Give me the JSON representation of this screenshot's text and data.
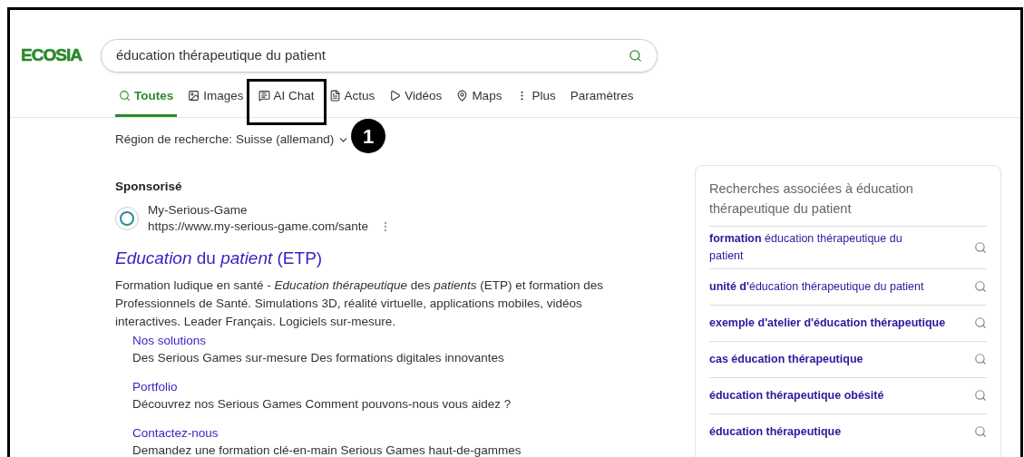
{
  "logo": "ECOSIA",
  "search": {
    "value": "éducation thérapeutique du patient"
  },
  "tabs": [
    {
      "label": "Toutes",
      "selected": true
    },
    {
      "label": "Images",
      "selected": false
    },
    {
      "label": "AI Chat",
      "selected": false
    },
    {
      "label": "Actus",
      "selected": false
    },
    {
      "label": "Vidéos",
      "selected": false
    },
    {
      "label": "Maps",
      "selected": false
    },
    {
      "label": "Plus",
      "selected": false
    },
    {
      "label": "Paramètres",
      "selected": false
    }
  ],
  "annotation": {
    "badge": "1"
  },
  "region": {
    "label": "Région de recherche:",
    "value": "Suisse (allemand)"
  },
  "ad": {
    "sponsored": "Sponsorisé",
    "site_name": "My-Serious-Game",
    "url": "https://www.my-serious-game.com/sante",
    "title": "*Education* du *patient* (ETP)",
    "description": "Formation ludique en santé - *Education thérapeutique* des *patients* (ETP) et formation des Professionnels de Santé. Simulations 3D, réalité virtuelle, applications mobiles, vidéos interactives. Leader Français. Logiciels sur-mesure.",
    "sitelinks": [
      {
        "title": "Nos solutions",
        "text": "Des Serious Games sur-mesure Des formations digitales innovantes"
      },
      {
        "title": "Portfolio",
        "text": "Découvrez nos Serious Games Comment pouvons-nous vous aidez ?"
      },
      {
        "title": "Contactez-nous",
        "text": "Demandez une formation clé-en-main Serious Games haut-de-gammes"
      }
    ]
  },
  "related": {
    "title": "Recherches associées à éducation thérapeutique du patient",
    "items": [
      {
        "text": "**formation** éducation thérapeutique du patient"
      },
      {
        "text": "**unité d'**éducation thérapeutique du patient"
      },
      {
        "text": "**exemple d'atelier d'éducation thérapeutique**"
      },
      {
        "text": "**cas éducation thérapeutique**"
      },
      {
        "text": "**éducation thérapeutique obésité**"
      },
      {
        "text": "**éducation thérapeutique**"
      }
    ]
  }
}
